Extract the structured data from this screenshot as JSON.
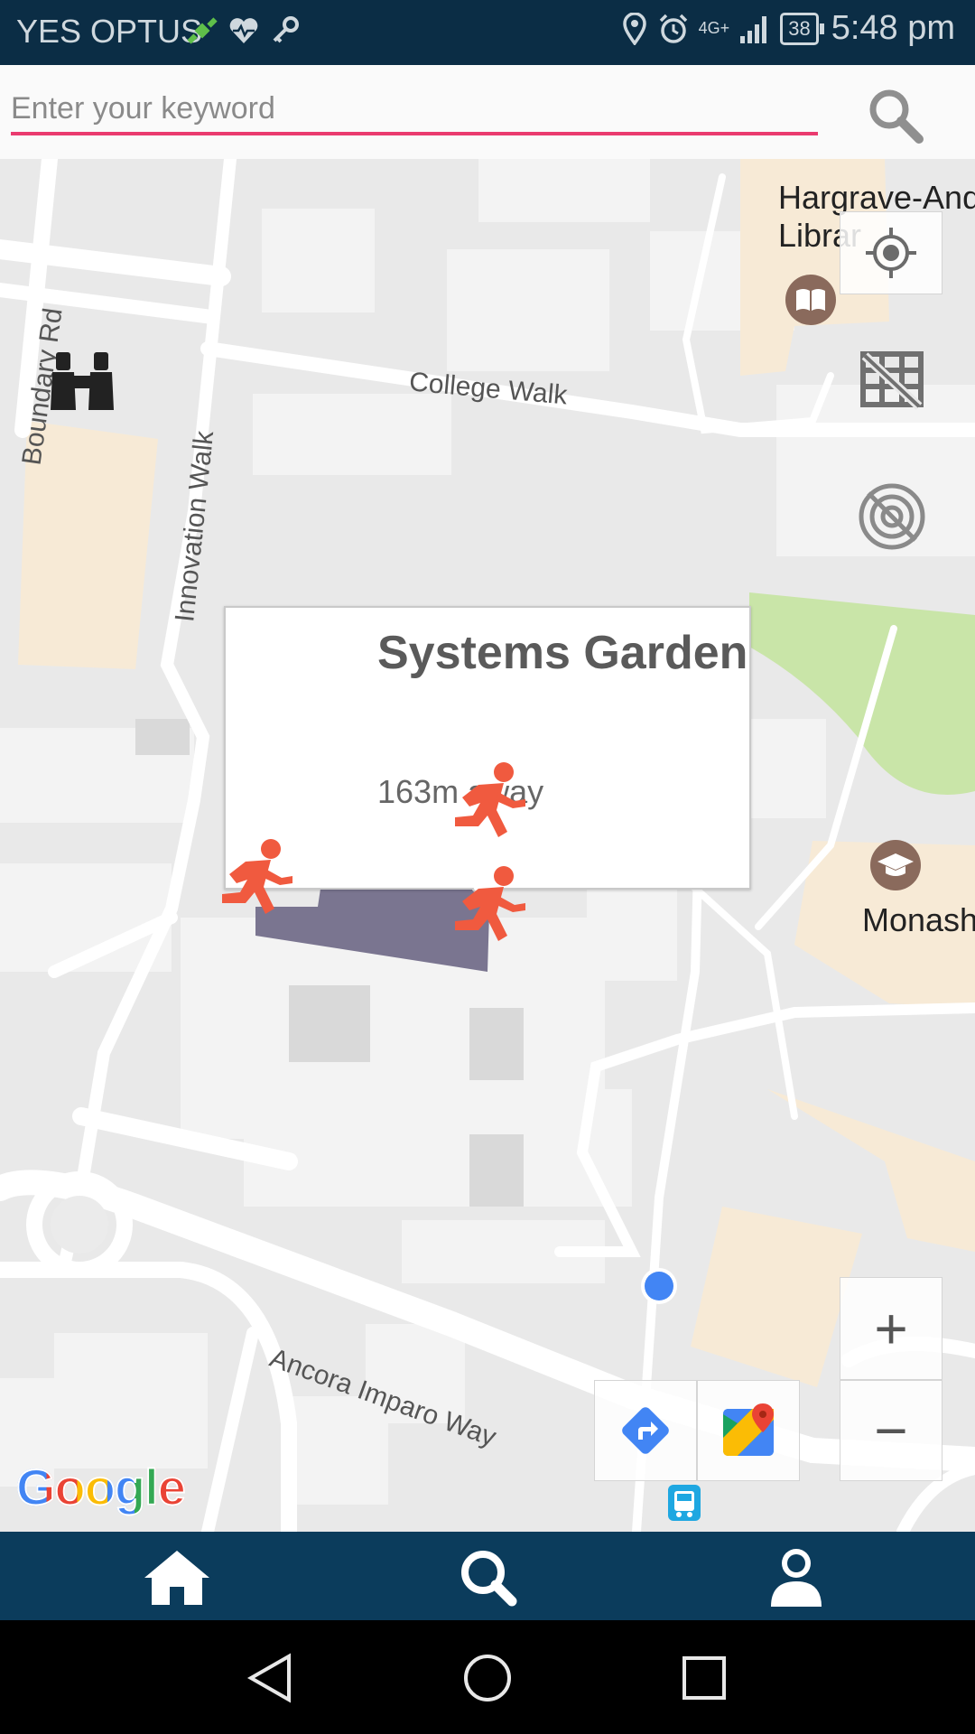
{
  "status_bar": {
    "carrier": "YES OPTUS",
    "network": "4G+",
    "battery": "38",
    "time": "5:48 pm"
  },
  "search": {
    "placeholder": "Enter your keyword"
  },
  "map": {
    "street_labels": [
      "Boundary Rd",
      "Innovation Walk",
      "College Walk",
      "Ancora Imparo Way"
    ],
    "poi_labels": {
      "library": "Hargrave-And\nLibrar",
      "monash": "Monash"
    },
    "attribution": "Google"
  },
  "info_window": {
    "title": "Systems Garden",
    "distance": "163m away"
  },
  "map_controls": {
    "zoom_in": "+",
    "zoom_out": "−"
  },
  "bottom_nav": {
    "items": [
      "home-icon",
      "search-icon",
      "user-icon"
    ]
  },
  "android_nav": {
    "items": [
      "back",
      "home",
      "recents"
    ]
  },
  "colors": {
    "status_bar": "#0b2d45",
    "bottom_nav": "#0b3c5c",
    "accent": "#ea3b6f",
    "marker": "#f05a3f",
    "garden_polygon": "#7a7590",
    "location_dot": "#4285f4"
  }
}
